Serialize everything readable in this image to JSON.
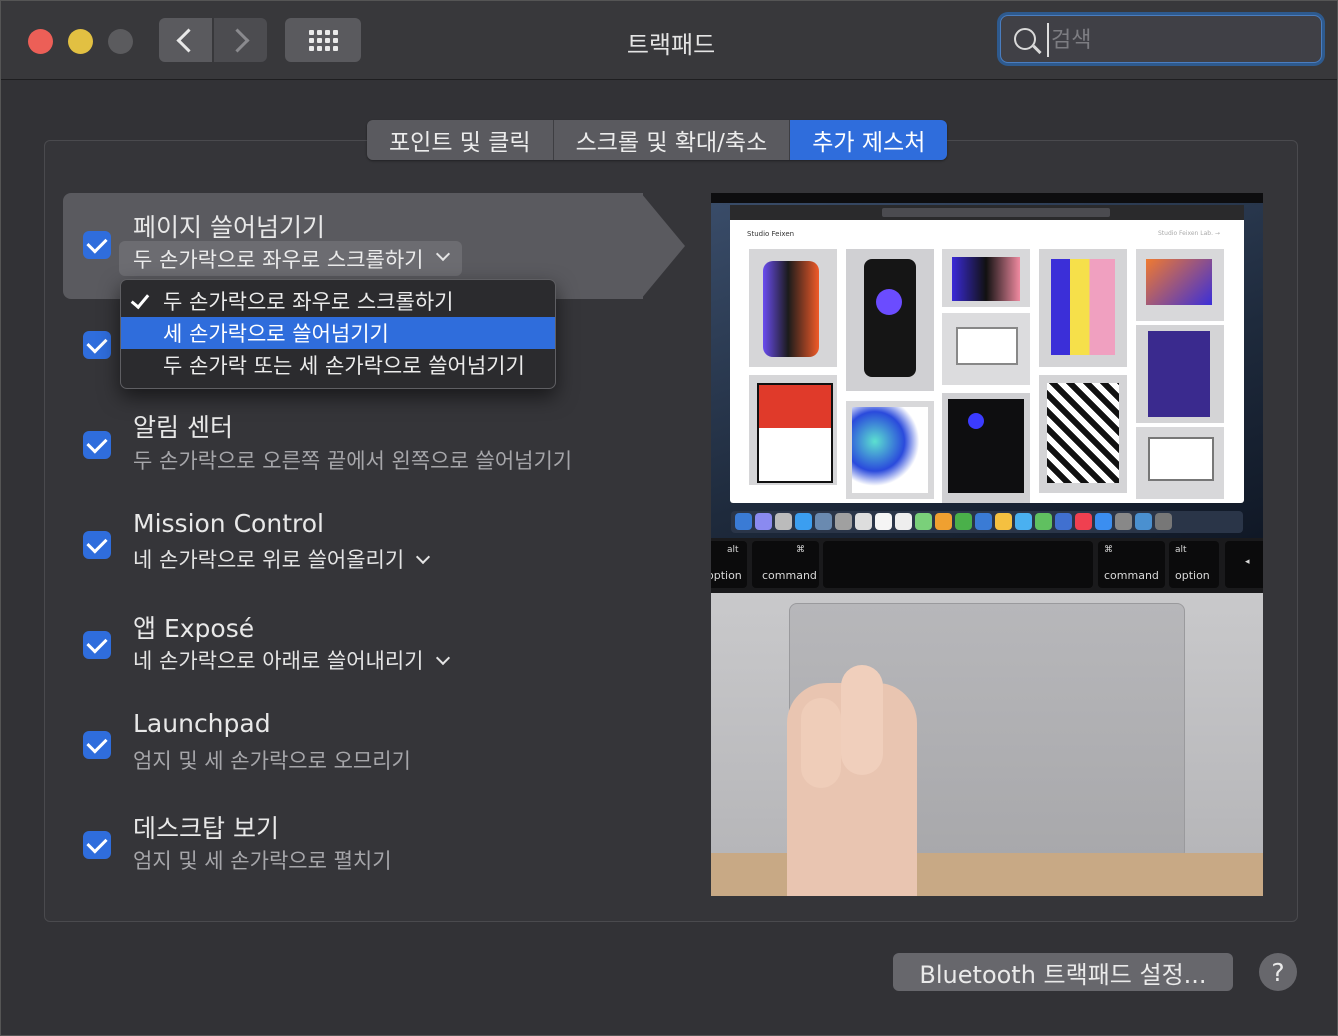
{
  "window": {
    "title": "트랙패드"
  },
  "search": {
    "placeholder": "검색"
  },
  "tabs": [
    {
      "label": "포인트 및 클릭"
    },
    {
      "label": "스크롤 및 확대/축소"
    },
    {
      "label": "추가 제스처",
      "active": true
    }
  ],
  "gestures": [
    {
      "title": "페이지 쓸어넘기기",
      "subtitle": "두 손가락으로 좌우로 스크롤하기",
      "checked": true,
      "popup": true
    },
    {
      "title": "",
      "subtitle": "",
      "checked": true
    },
    {
      "title": "알림 센터",
      "subtitle": "두 손가락으로 오른쪽 끝에서 왼쪽으로 쓸어넘기기",
      "checked": true
    },
    {
      "title": "Mission Control",
      "subtitle": "네 손가락으로 위로 쓸어올리기",
      "checked": true,
      "popup": true
    },
    {
      "title": "앱 Exposé",
      "subtitle": "네 손가락으로 아래로 쓸어내리기",
      "checked": true,
      "popup": true
    },
    {
      "title": "Launchpad",
      "subtitle": "엄지 및 세 손가락으로 오므리기",
      "checked": true
    },
    {
      "title": "데스크탑 보기",
      "subtitle": "엄지 및 세 손가락으로 펼치기",
      "checked": true
    }
  ],
  "dropdown": {
    "options": [
      {
        "label": "두 손가락으로 좌우로 스크롤하기",
        "checked": true
      },
      {
        "label": "세 손가락으로 쓸어넘기기",
        "highlighted": true
      },
      {
        "label": "두 손가락 또는 세 손가락으로 쓸어넘기기"
      }
    ]
  },
  "preview": {
    "site_name": "Studio Feixen",
    "site_link": "Studio Feixen Lab. →",
    "keys": [
      {
        "top": "alt",
        "bottom": "option"
      },
      {
        "top": "⌘",
        "bottom": "command"
      },
      {
        "top": "⌘",
        "bottom": "command"
      },
      {
        "top": "alt",
        "bottom": "option"
      }
    ]
  },
  "footer": {
    "bluetooth_button": "Bluetooth 트랙패드 설정...",
    "help": "?"
  },
  "colors": {
    "accent": "#2f6ddc",
    "window_bg": "#323236"
  }
}
